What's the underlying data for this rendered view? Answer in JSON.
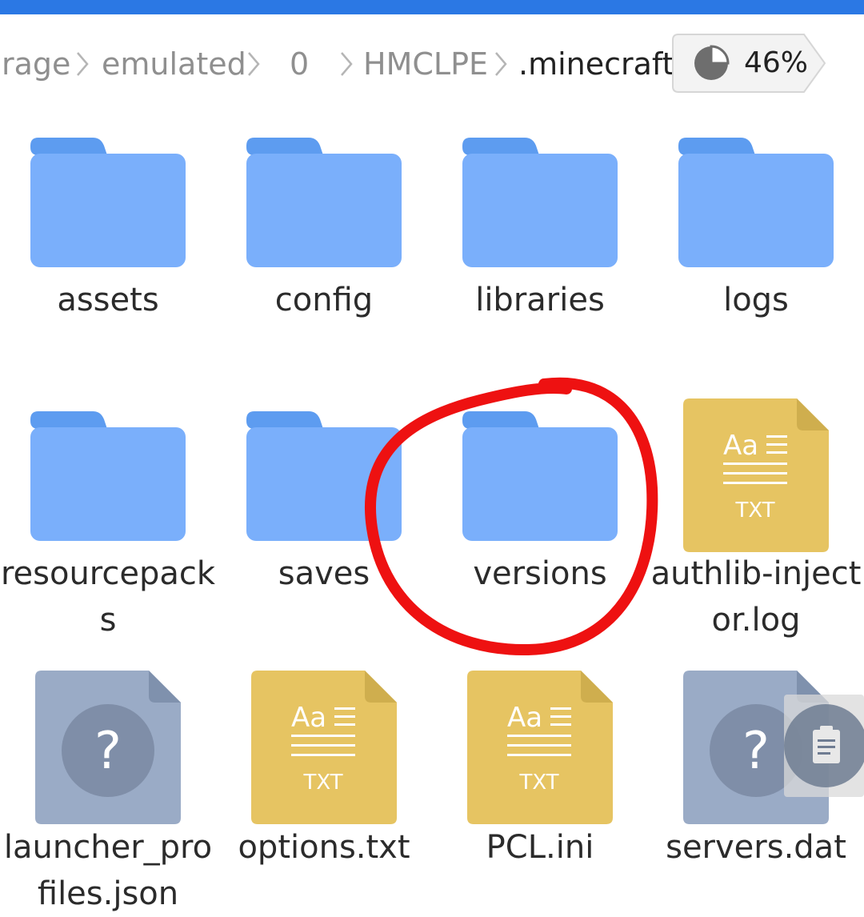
{
  "breadcrumb": {
    "items": [
      "rage",
      "emulated",
      "0",
      "HMCLPE",
      ".minecraft"
    ]
  },
  "storage": {
    "percent_label": "46%",
    "percent": 46
  },
  "files": [
    {
      "name": "assets",
      "kind": "folder",
      "icon": "folder-icon"
    },
    {
      "name": "config",
      "kind": "folder",
      "icon": "folder-icon"
    },
    {
      "name": "libraries",
      "kind": "folder",
      "icon": "folder-icon"
    },
    {
      "name": "logs",
      "kind": "folder",
      "icon": "folder-icon"
    },
    {
      "name": "resourcepacks",
      "kind": "folder",
      "icon": "folder-icon"
    },
    {
      "name": "saves",
      "kind": "folder",
      "icon": "folder-icon"
    },
    {
      "name": "versions",
      "kind": "folder",
      "icon": "folder-icon"
    },
    {
      "name": "authlib-injector.log",
      "kind": "text",
      "icon": "text-file-icon",
      "badge": "TXT",
      "glyph": "Aa"
    },
    {
      "name": "launcher_profiles.json",
      "kind": "unknown",
      "icon": "unknown-file-icon",
      "glyph": "?"
    },
    {
      "name": "options.txt",
      "kind": "text",
      "icon": "text-file-icon",
      "badge": "TXT",
      "glyph": "Aa"
    },
    {
      "name": "PCL.ini",
      "kind": "text",
      "icon": "text-file-icon",
      "badge": "TXT",
      "glyph": "Aa"
    },
    {
      "name": "servers.dat",
      "kind": "unknown",
      "icon": "unknown-file-icon",
      "glyph": "?"
    }
  ],
  "colors": {
    "topbar": "#2b78e4",
    "folder_back": "#5d9cf0",
    "folder_front": "#7aaffb",
    "text_file": "#e6c462",
    "text_file_fold": "#cfae4e",
    "unknown_file": "#9aabc6",
    "unknown_file_fold": "#7f91ad",
    "unknown_circle": "#7f8ea8",
    "annotation": "#ee1111"
  },
  "annotation": {
    "icon": "red-circle-annotation"
  },
  "floating_button": {
    "icon": "clipboard-icon"
  }
}
